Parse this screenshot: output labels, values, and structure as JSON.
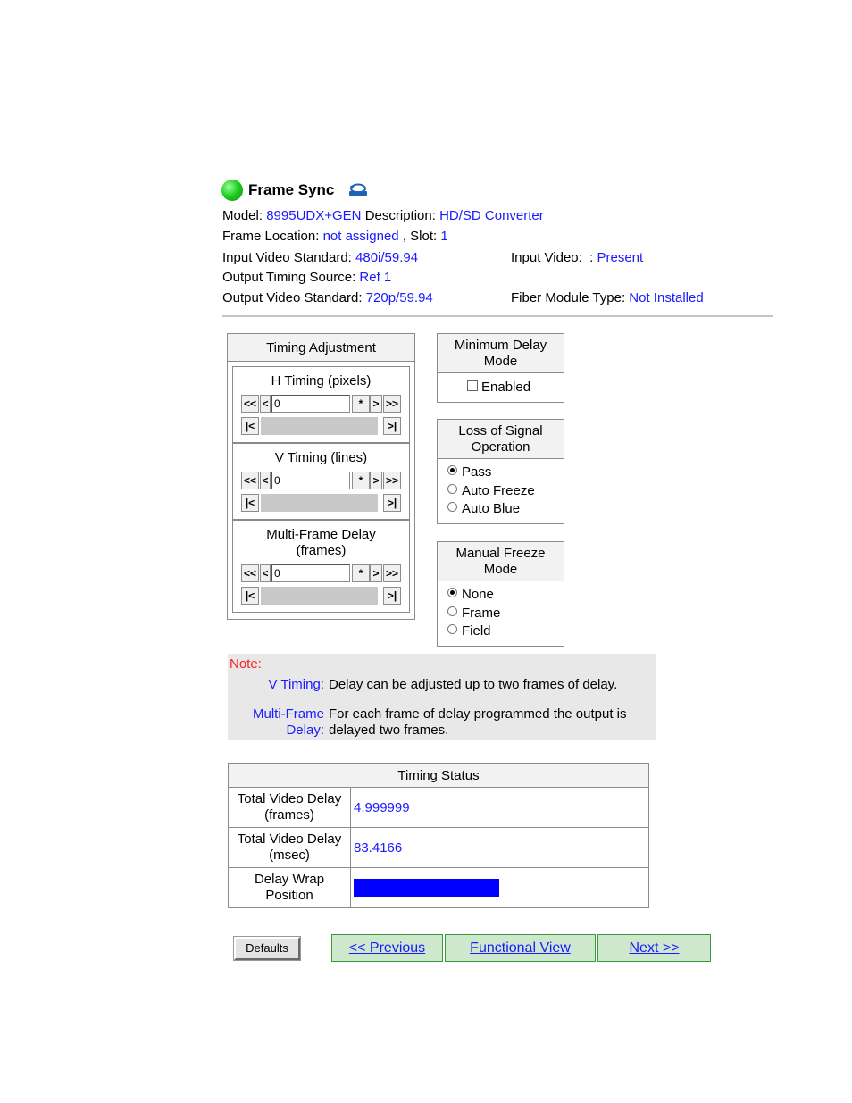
{
  "header": {
    "title": "Frame Sync",
    "model_label": "Model:",
    "model_value": "8995UDX+GEN",
    "description_label": "Description:",
    "description_value": "HD/SD Converter",
    "frame_location_label": "Frame Location:",
    "frame_location_value": "not assigned",
    "slot_label": ", Slot:",
    "slot_value": "1",
    "input_video_standard_label": "Input Video Standard:",
    "input_video_standard_value": "480i/59.94",
    "input_video_label": "Input Video:",
    "input_video_sep": ":",
    "input_video_value": "Present",
    "output_timing_source_label": "Output Timing Source:",
    "output_timing_source_value": "Ref 1",
    "output_video_standard_label": "Output Video Standard:",
    "output_video_standard_value": "720p/59.94",
    "fiber_module_label": "Fiber Module Type:",
    "fiber_module_value": "Not Installed",
    "status_color": "#22d122"
  },
  "timing_adjustment": {
    "title": "Timing Adjustment",
    "controls": [
      {
        "label_line1": "H Timing (pixels)",
        "label_line2": "",
        "value": "0"
      },
      {
        "label_line1": "V Timing (lines)",
        "label_line2": "",
        "value": "0"
      },
      {
        "label_line1": "Multi-Frame Delay",
        "label_line2": "(frames)",
        "value": "0"
      }
    ],
    "buttons": {
      "fast_back": "<<",
      "back": "<",
      "star": "*",
      "fwd": ">",
      "fast_fwd": ">>",
      "start": "|<",
      "end": ">|"
    }
  },
  "min_delay": {
    "title_line1": "Minimum Delay",
    "title_line2": "Mode",
    "option": "Enabled"
  },
  "loss_of_signal": {
    "title_line1": "Loss of Signal",
    "title_line2": "Operation",
    "options": [
      "Pass",
      "Auto Freeze",
      "Auto Blue"
    ],
    "selected": "Pass"
  },
  "manual_freeze": {
    "title_line1": "Manual Freeze",
    "title_line2": "Mode",
    "options": [
      "None",
      "Frame",
      "Field"
    ],
    "selected": "None"
  },
  "note": {
    "title": "Note:",
    "item1_label": "V Timing:",
    "item1_text": "Delay can be adjusted up to two frames of delay.",
    "item2_label_line1": "Multi-Frame",
    "item2_label_line2": "Delay:",
    "item2_text_line1": "For each frame of delay programmed the output is",
    "item2_text_line2": "delayed two frames."
  },
  "timing_status": {
    "title": "Timing Status",
    "rows": [
      {
        "label_line1": "Total Video Delay",
        "label_line2": "(frames)",
        "value": "4.999999"
      },
      {
        "label_line1": "Total Video Delay",
        "label_line2": "(msec)",
        "value": "83.4166"
      },
      {
        "label_line1": "Delay Wrap",
        "label_line2": "Position",
        "value": ""
      }
    ],
    "bar_color": "#0000ff"
  },
  "footer": {
    "defaults": "Defaults",
    "previous": "<< Previous",
    "functional_view": "Functional View",
    "next": "Next >>"
  }
}
